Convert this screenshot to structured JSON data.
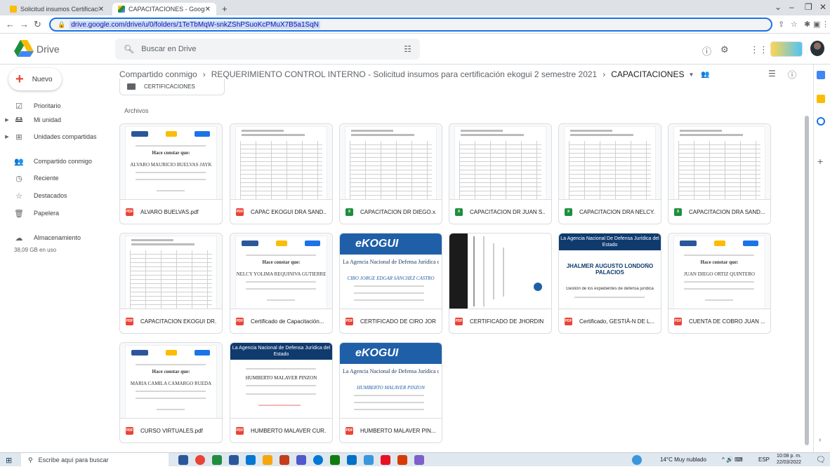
{
  "browser": {
    "tabs": [
      {
        "title": "Solicitud insumos Certificación E",
        "active": false
      },
      {
        "title": "CAPACITACIONES - Google Drive",
        "active": true
      }
    ],
    "url": "drive.google.com/drive/u/0/folders/1TeTbMqW-snkZShPSuoKcPMuX7B5a1SqN"
  },
  "drive": {
    "app_name": "Drive",
    "search_placeholder": "Buscar en Drive",
    "new_button": "Nuevo"
  },
  "sidebar": {
    "items": [
      {
        "label": "Prioritario",
        "icon": "priority-icon"
      },
      {
        "label": "Mi unidad",
        "icon": "my-drive-icon"
      },
      {
        "label": "Unidades compartidas",
        "icon": "shared-drives-icon"
      },
      {
        "label": "Compartido conmigo",
        "icon": "shared-with-me-icon"
      },
      {
        "label": "Reciente",
        "icon": "clock-icon"
      },
      {
        "label": "Destacados",
        "icon": "star-icon"
      },
      {
        "label": "Papelera",
        "icon": "trash-icon"
      },
      {
        "label": "Almacenamiento",
        "icon": "cloud-icon"
      }
    ],
    "storage_used": "38,09 GB en uso"
  },
  "breadcrumb": {
    "root": "Compartido conmigo",
    "parent": "REQUERIMIENTO CONTROL INTERNO - Solicitud insumos para certificación ekogui 2 semestre 2021",
    "current": "CAPACITACIONES"
  },
  "folders": [
    {
      "name": "CERTIFICACIONES"
    }
  ],
  "files_section_label": "Archivos",
  "files": [
    {
      "name": "ALVARO BUELVAS.pdf",
      "type": "pdf",
      "thumb": "cert",
      "thumb_name": "ALVARO MAURICIO BUELVAS JAYK",
      "thumb_heading": "Hace constar que:"
    },
    {
      "name": "CAPAC EKOGUI DRA SAND...",
      "type": "pdf",
      "thumb": "sheet"
    },
    {
      "name": "CAPACITACION DR DIEGO.x...",
      "type": "xls",
      "thumb": "sheet"
    },
    {
      "name": "CAPACITACION DR JUAN S...",
      "type": "xls",
      "thumb": "sheet"
    },
    {
      "name": "CAPACITACION DRA NELCY...",
      "type": "xls",
      "thumb": "sheet"
    },
    {
      "name": "CAPACITACION DRA SAND...",
      "type": "xls",
      "thumb": "sheet"
    },
    {
      "name": "CAPACITACION EKOGUI DR...",
      "type": "pdf",
      "thumb": "sheet"
    },
    {
      "name": "Certificado de Capacitación...",
      "type": "pdf",
      "thumb": "cert",
      "thumb_name": "NELCY YOLIMA REQUINIVA GUTIERRE",
      "thumb_heading": "Hace constar que:"
    },
    {
      "name": "CERTIFICADO DE CIRO JOR...",
      "type": "pdf",
      "thumb": "egui",
      "thumb_org": "La Agencia Nacional de Defensa Jurídica del Estad",
      "thumb_name": "CIRO JORGE EDGAR SÁNCHEZ CASTRO",
      "thumb_logo": "eKOGUI"
    },
    {
      "name": "CERTIFICADO DE JHORDIN ...",
      "type": "pdf",
      "thumb": "rotated"
    },
    {
      "name": "Certificado, GESTIÃ-N DE L...",
      "type": "pdf",
      "thumb": "anjde",
      "thumb_org": "La Agencia Nacional De Defensa Jurídica del Estado",
      "thumb_name": "JHALMER AUGUSTO LONDOÑO PALACIOS",
      "thumb_course": "Gestión de los expedientes de defensa jurídica"
    },
    {
      "name": "CUENTA DE COBRO JUAN ...",
      "type": "pdf",
      "thumb": "cert",
      "thumb_name": "JUAN DIEGO ORTIZ QUINTERO",
      "thumb_heading": "Hace constar que:"
    },
    {
      "name": "CURSO VIRTUALES.pdf",
      "type": "pdf",
      "thumb": "cert",
      "thumb_name": "MARIA CAMILA CAMARGO RUEDA",
      "thumb_heading": "Hace constar que:"
    },
    {
      "name": "HUMBERTO MALAVER CUR...",
      "type": "pdf",
      "thumb": "anjde2",
      "thumb_org": "La Agencia Nacional de Defensa Jurídica del Estado",
      "thumb_name": "HUMBERTO MALAVER PINZON"
    },
    {
      "name": "HUMBERTO MALAVER PIN...",
      "type": "pdf",
      "thumb": "egui",
      "thumb_org": "La Agencia Nacional de Defensa Jurídica del Estad",
      "thumb_name": "HUMBERTO MALAVER PINZON",
      "thumb_logo": "eKOGUI"
    }
  ],
  "taskbar": {
    "search_placeholder": "Escribe aquí para buscar",
    "weather": "14°C  Muy nublado",
    "lang": "ESP",
    "time": "10:08 p. m.",
    "date": "22/03/2022"
  },
  "colors": {
    "accent": "#1a73e8",
    "pdf": "#ea4335",
    "sheet": "#1e8e3e"
  }
}
